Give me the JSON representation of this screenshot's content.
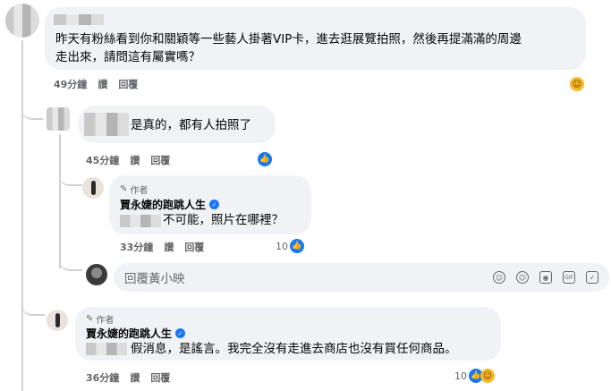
{
  "comments": [
    {
      "author": "",
      "text_line1": "昨天有粉絲看到你和關穎等一些藝人掛著VIP卡，進去逛展覽拍照，然後再提滿滿的周邊",
      "text_line2": "走出來，請問這有屬實嗎？",
      "time": "49分鐘",
      "like_label": "讚",
      "reply_label": "回覆",
      "reaction_icon": "haha-emoji-icon"
    },
    {
      "text": "是真的，都有人拍照了",
      "time": "45分鐘",
      "like_label": "讚",
      "reply_label": "回覆",
      "reaction_icon": "like-icon"
    },
    {
      "author_badge": "作者",
      "author": "賈永婕的跑跳人生",
      "text": "不可能，照片在哪裡？",
      "time": "33分鐘",
      "like_label": "讚",
      "reply_label": "回覆",
      "reaction_count": "10"
    },
    {
      "author_badge": "作者",
      "author": "賈永婕的跑跳人生",
      "text": "假消息，是謠言。我完全沒有走進去商店也沒有買任何商品。",
      "time": "36分鐘",
      "like_label": "讚",
      "reply_label": "回覆",
      "reaction_count": "10"
    }
  ],
  "reply_input": {
    "placeholder": "回覆黃小映",
    "icons": [
      "avatar-icon",
      "smile-icon",
      "camera-icon",
      "gif-icon",
      "sticker-icon"
    ]
  },
  "colors": {
    "bubble": "#f0f2f5",
    "meta": "#65676b",
    "like": "#1877f2",
    "haha": "#f7b928"
  }
}
